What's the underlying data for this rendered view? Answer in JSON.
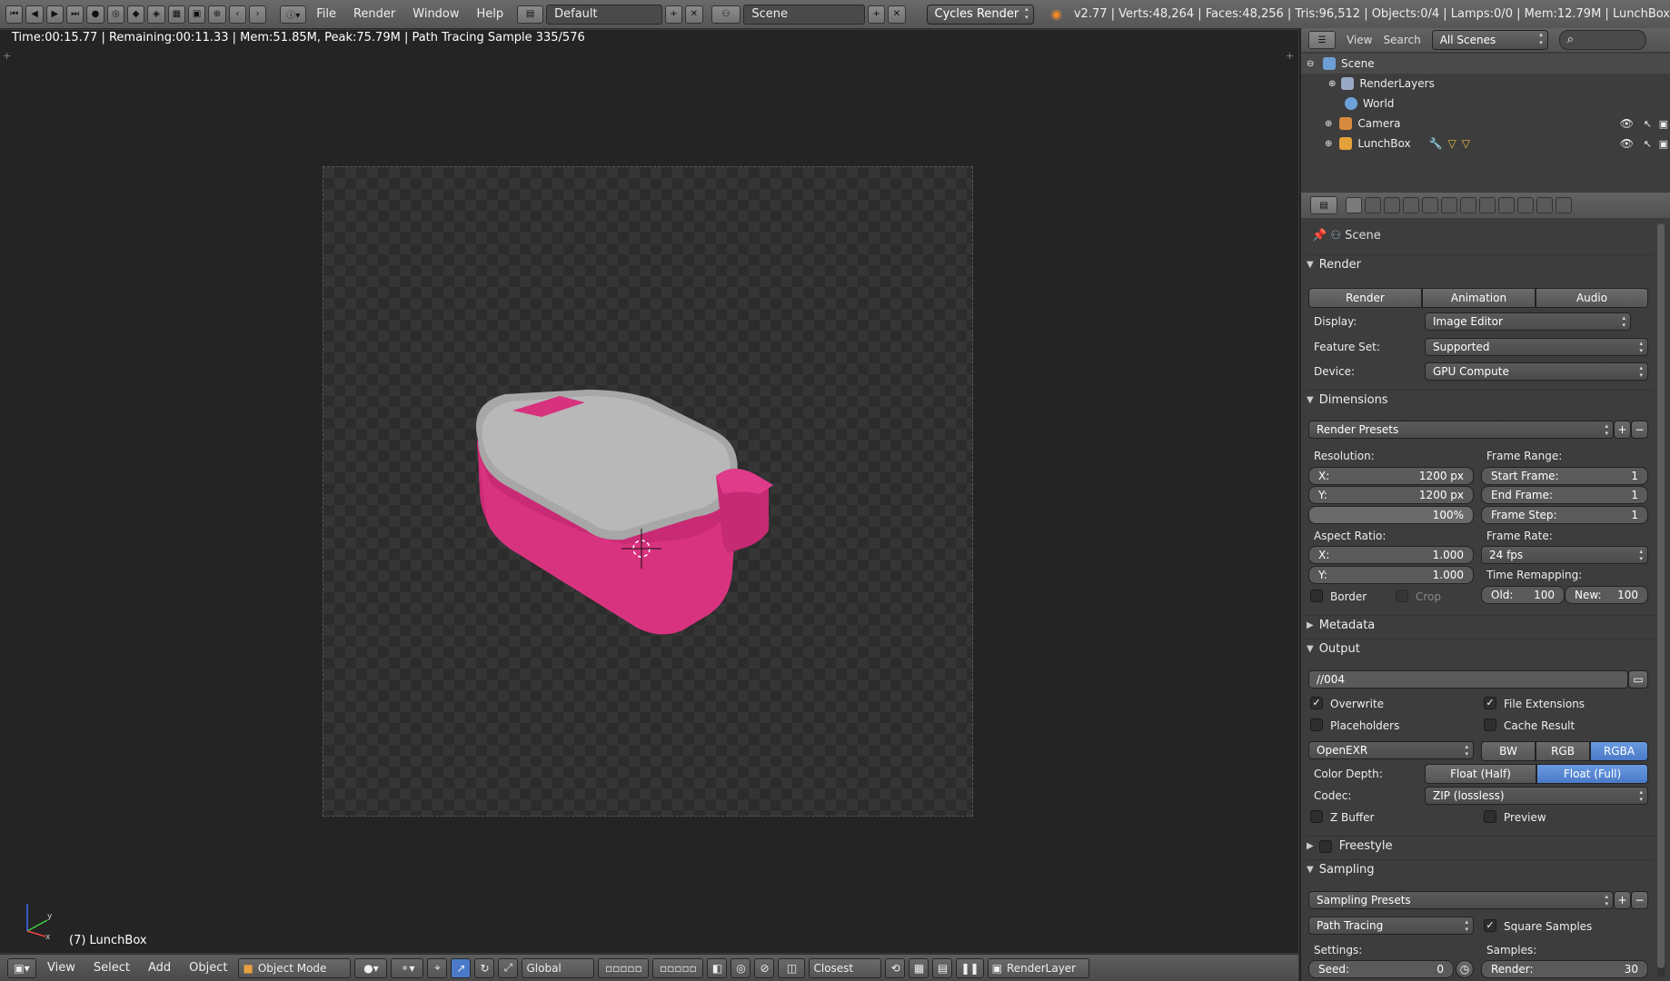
{
  "menus": [
    "File",
    "Render",
    "Window",
    "Help"
  ],
  "topbar": {
    "screen_layout": "Default",
    "scene": "Scene",
    "engine": "Cycles Render",
    "stats": "v2.77 | Verts:48,264 | Faces:48,256 | Tris:96,512 | Objects:0/4 | Lamps:0/0 | Mem:12.79M | LunchBox"
  },
  "viewport": {
    "render_info": "Time:00:15.77 | Remaining:00:11.33 | Mem:51.85M, Peak:75.79M | Path Tracing Sample 335/576",
    "object_label": "(7) LunchBox",
    "axis_x": "x",
    "axis_y": "y"
  },
  "bottombar": {
    "view": "View",
    "select": "Select",
    "add": "Add",
    "object": "Object",
    "mode": "Object Mode",
    "orientation": "Global",
    "snap": "Closest",
    "render_layer": "RenderLayer"
  },
  "outliner": {
    "view": "View",
    "search": "Search",
    "filter": "All Scenes",
    "items": [
      {
        "label": "Scene",
        "color": "#6d9fd6"
      },
      {
        "label": "RenderLayers",
        "color": "#9aa9c5"
      },
      {
        "label": "World",
        "color": "#6da2d8"
      },
      {
        "label": "Camera",
        "color": "#d78a3e"
      },
      {
        "label": "LunchBox",
        "color": "#e6a23a"
      }
    ]
  },
  "props": {
    "context": "Scene",
    "render": {
      "title": "Render",
      "buttons": [
        "Render",
        "Animation",
        "Audio"
      ],
      "display_label": "Display:",
      "display": "Image Editor",
      "featureset_label": "Feature Set:",
      "featureset": "Supported",
      "device_label": "Device:",
      "device": "GPU Compute"
    },
    "dimensions": {
      "title": "Dimensions",
      "presets": "Render Presets",
      "resolution_label": "Resolution:",
      "res_x_label": "X:",
      "res_x": "1200 px",
      "res_y_label": "Y:",
      "res_y": "1200 px",
      "res_pct": "100%",
      "framerange_label": "Frame Range:",
      "start_label": "Start Frame:",
      "start": "1",
      "end_label": "End Frame:",
      "end": "1",
      "step_label": "Frame Step:",
      "step": "1",
      "aspect_label": "Aspect Ratio:",
      "asp_x_label": "X:",
      "asp_x": "1.000",
      "asp_y_label": "Y:",
      "asp_y": "1.000",
      "framerate_label": "Frame Rate:",
      "fps": "24 fps",
      "remap_label": "Time Remapping:",
      "old_label": "Old:",
      "old": "100",
      "new_label": "New:",
      "new": "100",
      "border": "Border",
      "crop": "Crop"
    },
    "metadata_title": "Metadata",
    "output": {
      "title": "Output",
      "path": "//004",
      "overwrite": "Overwrite",
      "file_ext": "File Extensions",
      "placeholders": "Placeholders",
      "cache": "Cache Result",
      "format": "OpenEXR",
      "bw": "BW",
      "rgb": "RGB",
      "rgba": "RGBA",
      "depth_label": "Color Depth:",
      "half": "Float (Half)",
      "full": "Float (Full)",
      "codec_label": "Codec:",
      "codec": "ZIP (lossless)",
      "zbuffer": "Z Buffer",
      "preview": "Preview"
    },
    "freestyle_title": "Freestyle",
    "sampling": {
      "title": "Sampling",
      "presets": "Sampling Presets",
      "integrator": "Path Tracing",
      "square": "Square Samples",
      "settings_label": "Settings:",
      "samples_label": "Samples:",
      "seed_label": "Seed:",
      "seed": "0",
      "render_label": "Render:",
      "render": "30"
    }
  },
  "colors": {
    "accent": "#5680c2",
    "object": "#d8327e"
  }
}
